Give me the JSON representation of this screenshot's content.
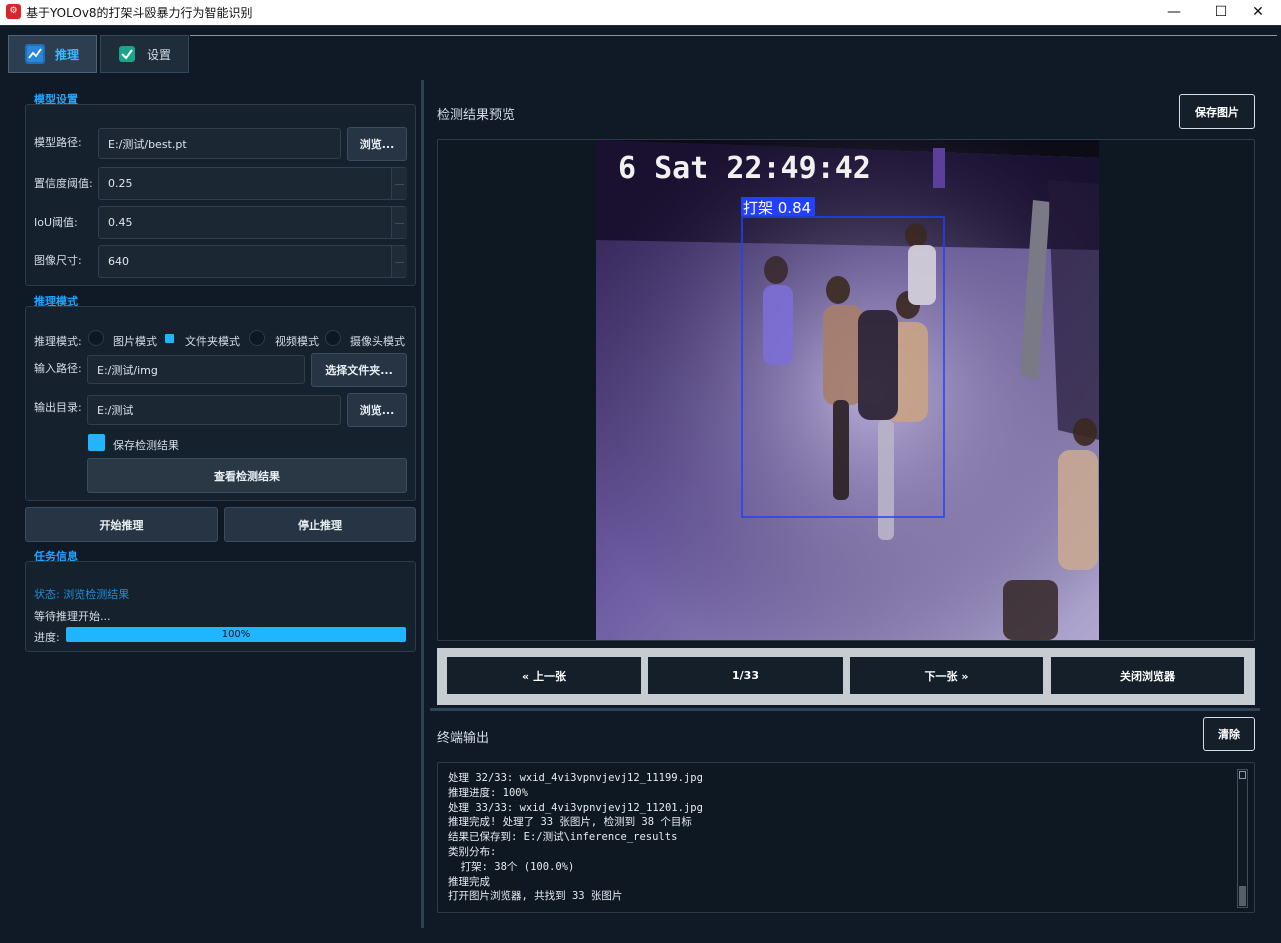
{
  "window": {
    "title": "基于YOLOv8的打架斗殴暴力行为智能识别",
    "icon": "app-logo-icon",
    "minimize": "—",
    "maximize": "☐",
    "close": "✕"
  },
  "tabs": [
    {
      "label": "推理",
      "icon": "chart-line-icon",
      "active": true
    },
    {
      "label": "设置",
      "icon": "checkbox-icon",
      "active": false
    }
  ],
  "model": {
    "section_title": "模型设置",
    "path_label": "模型路径:",
    "path_value": "E:/测试/best.pt",
    "browse_label": "浏览...",
    "conf_label": "置信度阈值:",
    "conf_value": "0.25",
    "iou_label": "IoU阈值:",
    "iou_value": "0.45",
    "size_label": "图像尺寸:",
    "size_value": "640"
  },
  "inference": {
    "section_title": "推理模式",
    "mode_label": "推理模式:",
    "modes": [
      "图片模式",
      "文件夹模式",
      "视频模式",
      "摄像头模式"
    ],
    "selected_mode": "文件夹模式",
    "input_label": "输入路径:",
    "input_value": "E:/测试/img",
    "select_folder_label": "选择文件夹...",
    "output_label": "输出目录:",
    "output_value": "E:/测试",
    "output_browse_label": "浏览...",
    "save_results_label": "保存检测结果",
    "save_results_checked": true,
    "view_results_label": "查看检测结果"
  },
  "actions": {
    "start_label": "开始推理",
    "stop_label": "停止推理"
  },
  "task": {
    "section_title": "任务信息",
    "status_text": "状态: 浏览检测结果",
    "waiting_text": "等待推理开始...",
    "progress_label": "进度:",
    "progress_text": "100%",
    "progress_value": 1.0
  },
  "preview": {
    "title": "检测结果预览",
    "save_image_label": "保存图片",
    "frame_timestamp": "6 Sat 22:49:42",
    "detection_label": "打架 0.84",
    "box_color": "#2140ff"
  },
  "navigator": {
    "prev_label": "« 上一张",
    "counter": "1/33",
    "next_label": "下一张 »",
    "close_label": "关闭浏览器"
  },
  "terminal": {
    "title": "终端输出",
    "clear_label": "清除",
    "lines": [
      "处理 32/33: wxid_4vi3vpnvjevj12_11199.jpg",
      "推理进度: 100%",
      "处理 33/33: wxid_4vi3vpnvjevj12_11201.jpg",
      "推理完成! 处理了 33 张图片, 检测到 38 个目标",
      "结果已保存到: E:/测试\\inference_results",
      "类别分布:",
      "  打架: 38个 (100.0%)",
      "推理完成",
      "打开图片浏览器, 共找到 33 张图片"
    ]
  },
  "colors": {
    "accent": "#1fb6ff",
    "section_title": "#1fa4ff",
    "background": "#0f1a26"
  }
}
